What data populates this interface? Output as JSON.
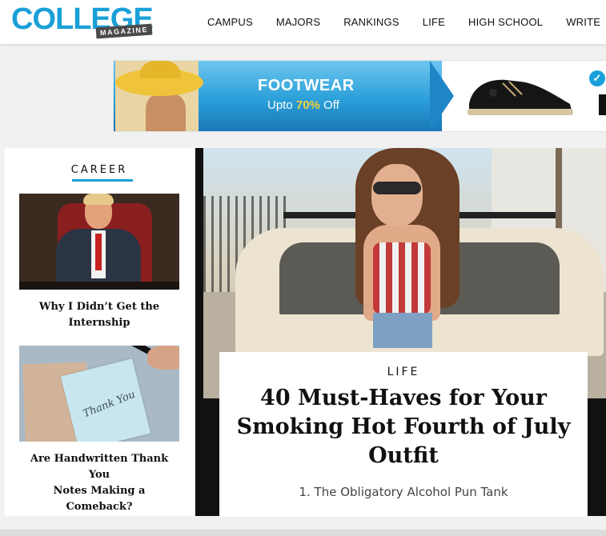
{
  "header": {
    "logo_main": "COLLEGE",
    "logo_sub": "MAGAZINE",
    "nav": [
      "CAMPUS",
      "MAJORS",
      "RANKINGS",
      "LIFE",
      "HIGH SCHOOL",
      "WRITE"
    ]
  },
  "ad": {
    "title": "FOOTWEAR",
    "sub_prefix": "Upto ",
    "sub_pct": "70%",
    "sub_suffix": " Off"
  },
  "sidebar": {
    "category": "CAREER",
    "articles": [
      {
        "title_line1": "Why I Didn’t Get the",
        "title_line2": "Internship"
      },
      {
        "title_line1": "Are Handwritten Thank You",
        "title_line2": "Notes Making a Comeback?",
        "image_text": "Thank You"
      }
    ]
  },
  "feature": {
    "category": "LIFE",
    "title_line1": "40 Must-Haves for Your",
    "title_line2": "Smoking Hot Fourth of July",
    "title_line3": "Outfit",
    "excerpt": "1. The Obligatory Alcohol Pun Tank"
  },
  "colors": {
    "brand_blue": "#1aa0d8",
    "ad_yellow": "#f5d23a"
  }
}
